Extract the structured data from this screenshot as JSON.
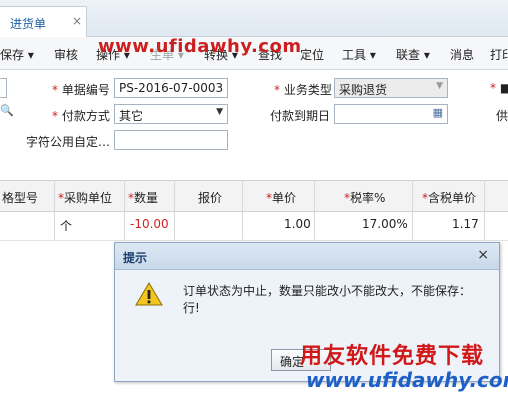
{
  "tab": {
    "label": "进货单",
    "close": "×"
  },
  "toolbar": {
    "items": [
      "保存 ▾",
      "审核",
      "操作 ▾",
      "生单 ▾",
      "转换 ▾",
      "查找",
      "定位",
      "工具 ▾",
      "联查 ▾",
      "消息",
      "打印"
    ],
    "watermark": "www.ufidawhy.com"
  },
  "form": {
    "doc_no_label": "单据编号",
    "doc_no_value": "PS-2016-07-0003",
    "biz_type_label": "业务类型",
    "biz_type_value": "采购退货",
    "pay_method_label": "付款方式",
    "pay_method_value": "其它",
    "pay_due_label": "付款到期日",
    "custom_label": "字符公用自定…",
    "right_req": "*",
    "right_partial": "供",
    "star": "*"
  },
  "grid": {
    "headers": [
      "格型号",
      "采购单位",
      "数量",
      "报价",
      "单价",
      "税率%",
      "含税单价"
    ],
    "required": [
      false,
      true,
      true,
      false,
      true,
      true,
      true
    ],
    "row": [
      "",
      "个",
      "-10.00",
      "",
      "1.00",
      "17.00%",
      "1.17"
    ]
  },
  "dialog": {
    "title": "提示",
    "close": "×",
    "message": "订单状态为中止，数量只能改小不能改大，不能保存：行!",
    "ok": "确定"
  },
  "watermarks": {
    "cn": "用友软件免费下载",
    "en": "www.ufidawhy.com"
  },
  "colors": {
    "accent": "#1f5fa0",
    "required": "#d02020",
    "negative": "#cc2222"
  }
}
